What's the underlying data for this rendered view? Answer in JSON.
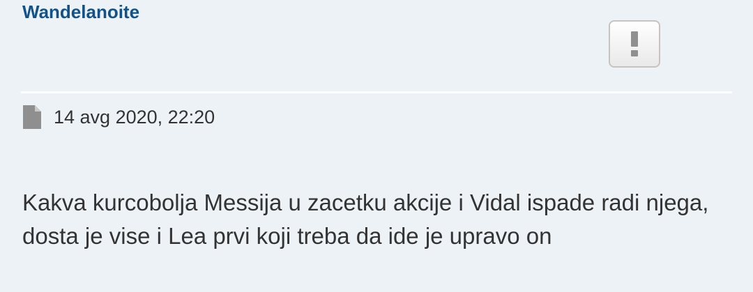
{
  "post": {
    "author": "Wandelanoite",
    "report_label": "!",
    "date": "14 avg 2020, 22:20",
    "body": "Kakva kurcobolja Messija u zacetku akcije i Vidal ispade radi njega, dosta je vise i Lea prvi koji treba da ide je upravo on"
  },
  "icons": {
    "report": "exclamation-icon",
    "post": "document-icon"
  },
  "colors": {
    "background": "#ecf2f6",
    "username": "#105289",
    "text": "#333333",
    "icon": "#8f8f8f"
  }
}
